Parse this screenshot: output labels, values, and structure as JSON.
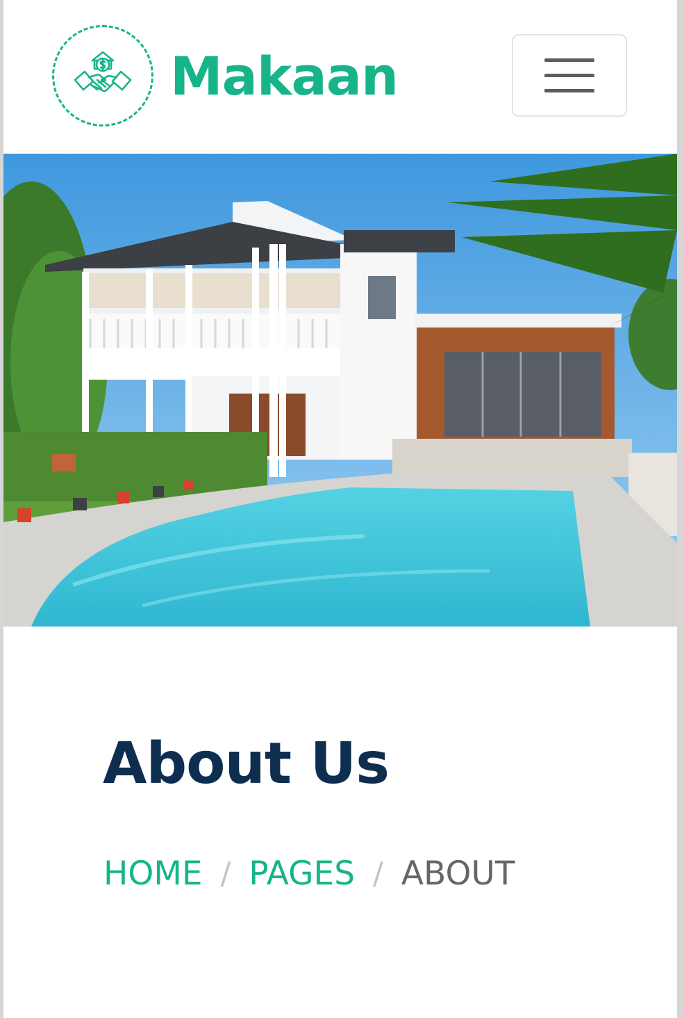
{
  "brand": {
    "name": "Makaan",
    "logo_icon": "handshake-money-icon",
    "color": "#17b48a"
  },
  "navbar": {
    "menu_icon": "hamburger-menu-icon"
  },
  "hero": {
    "image": "house-with-pool-photo"
  },
  "page_header": {
    "title": "About Us",
    "title_color": "#0e2e50",
    "breadcrumb": [
      {
        "label": "HOME",
        "link": true
      },
      {
        "label": "PAGES",
        "link": true
      },
      {
        "label": "ABOUT",
        "link": false
      }
    ],
    "separator": "/"
  }
}
